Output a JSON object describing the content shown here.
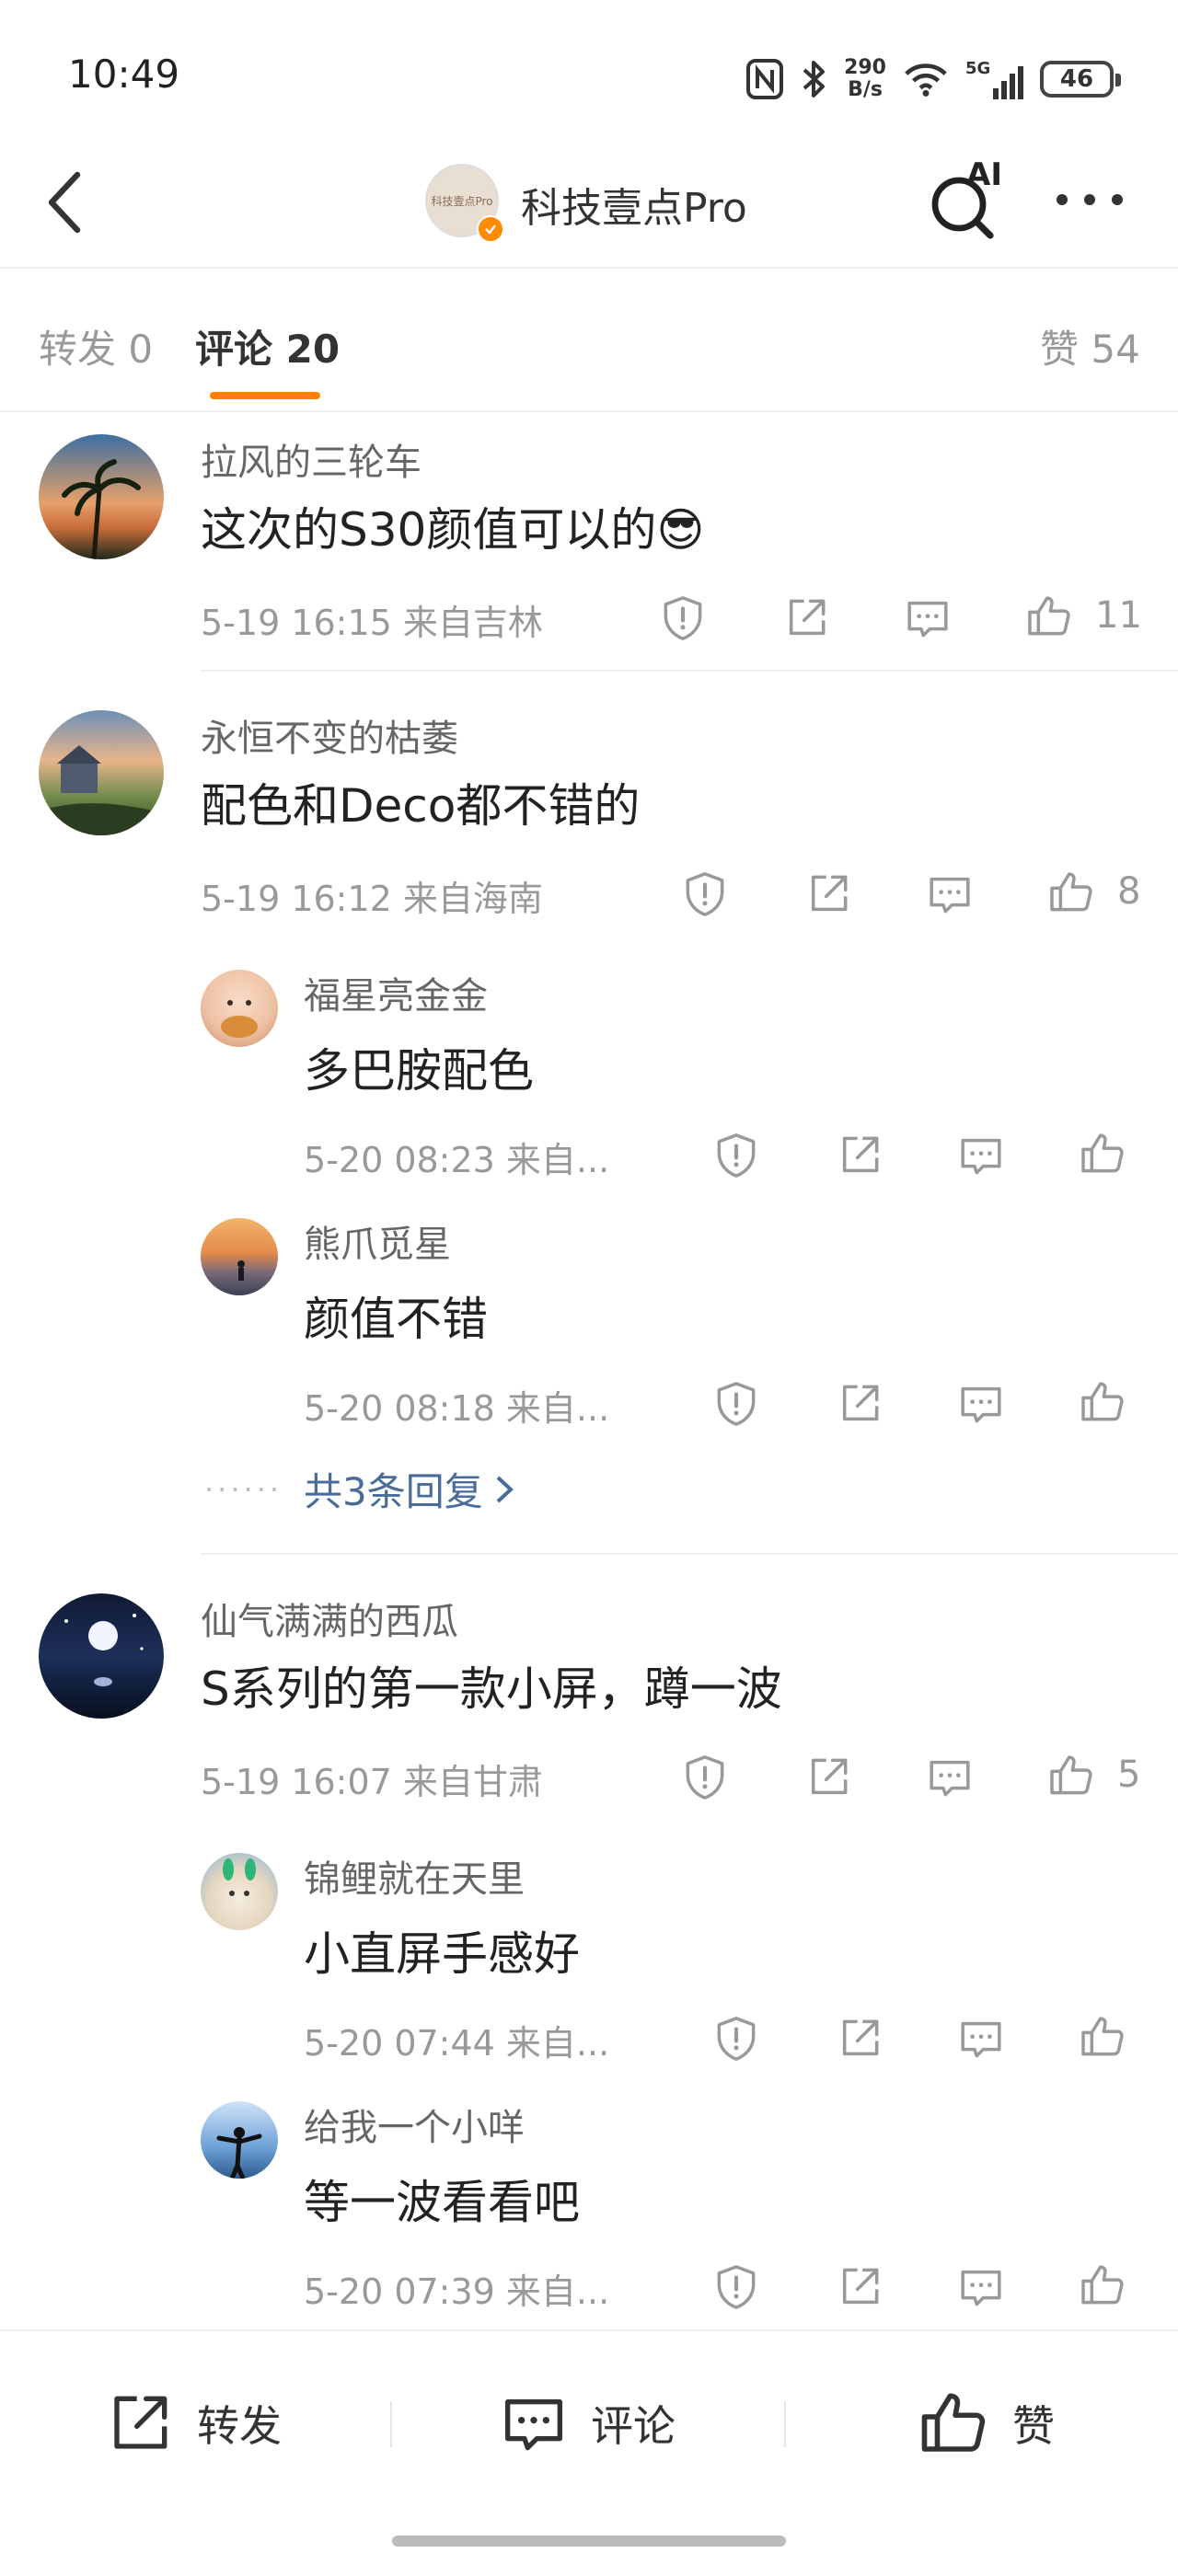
{
  "status_bar": {
    "time": "10:49",
    "speed_value": "290",
    "speed_unit": "B/s",
    "network": "5G",
    "battery": "46"
  },
  "header": {
    "account_name": "科技壹点Pro",
    "avatar_logo_text": "科技壹点Pro",
    "ai_label": "AI"
  },
  "tabs": {
    "forward": "转发 0",
    "comments": "评论 20",
    "likes": "赞 54"
  },
  "comments": [
    {
      "user": "拉风的三轮车",
      "text": "这次的S30颜值可以的😎",
      "meta": "5-19 16:15  来自吉林",
      "likes": "11"
    },
    {
      "user": "永恒不变的枯萎",
      "text": "配色和Deco都不错的",
      "meta": "5-19 16:12  来自海南",
      "likes": "8",
      "replies": [
        {
          "user": "福星亮金金",
          "text": "多巴胺配色",
          "meta": "5-20 08:23  来自..."
        },
        {
          "user": "熊爪觅星",
          "text": "颜值不错",
          "meta": "5-20 08:18  来自..."
        }
      ],
      "more_replies": "共3条回复",
      "more_dots": "······"
    },
    {
      "user": "仙气满满的西瓜",
      "text": "S系列的第一款小屏，蹲一波",
      "meta": "5-19 16:07  来自甘肃",
      "likes": "5",
      "replies": [
        {
          "user": "锦鲤就在天里",
          "text": "小直屏手感好",
          "meta": "5-20 07:44  来自..."
        },
        {
          "user": "给我一个小咩",
          "text": "等一波看看吧",
          "meta": "5-20 07:39  来自..."
        }
      ]
    }
  ],
  "bottom_bar": {
    "forward": "转发",
    "comment": "评论",
    "like": "赞"
  },
  "colors": {
    "accent": "#ff8200",
    "link": "#4a6c9a",
    "text_primary": "#222222",
    "text_secondary": "#999999"
  }
}
